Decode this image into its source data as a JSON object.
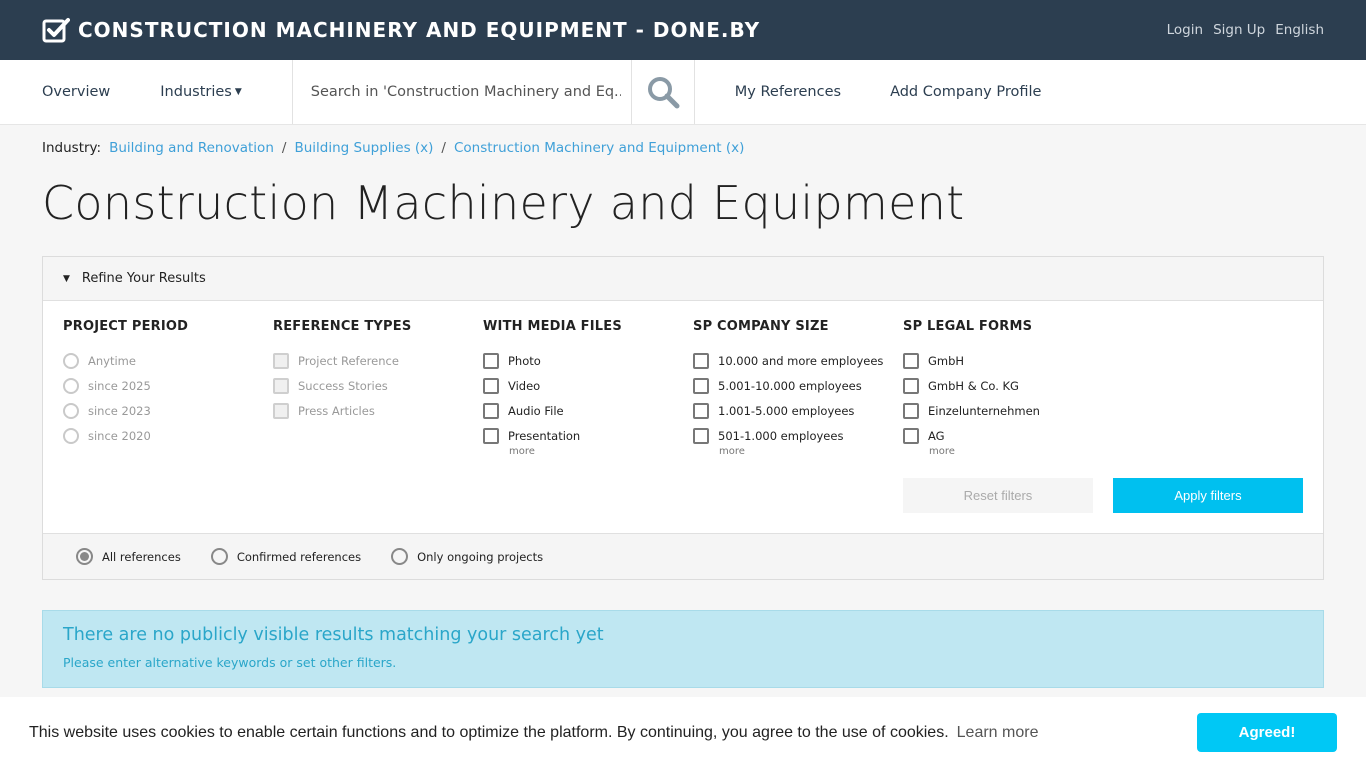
{
  "topbar": {
    "brand": "CONSTRUCTION MACHINERY AND EQUIPMENT - DONE.BY",
    "links": [
      "Login",
      "Sign Up",
      "English"
    ]
  },
  "nav": {
    "overview": "Overview",
    "industries": "Industries",
    "search_placeholder": "Search in 'Construction Machinery and Eq...",
    "my_references": "My References",
    "add_profile": "Add Company Profile"
  },
  "breadcrumb": {
    "label": "Industry:",
    "items": [
      "Building and Renovation",
      "Building Supplies (x)",
      "Construction Machinery and Equipment (x)"
    ]
  },
  "page": {
    "title": "Construction Machinery and Equipment"
  },
  "filters": {
    "header": "Refine Your Results",
    "columns": [
      {
        "title": "PROJECT PERIOD",
        "options": [
          "Anytime",
          "since 2025",
          "since 2023",
          "since 2020"
        ]
      },
      {
        "title": "REFERENCE TYPES",
        "options": [
          "Project Reference",
          "Success Stories",
          "Press Articles"
        ]
      },
      {
        "title": "WITH MEDIA FILES",
        "options": [
          "Photo",
          "Video",
          "Audio File",
          "Presentation"
        ],
        "more": "more"
      },
      {
        "title": "SP COMPANY SIZE",
        "options": [
          "10.000 and more employees",
          "5.001-10.000 employees",
          "1.001-5.000 employees",
          "501-1.000 employees"
        ],
        "more": "more"
      },
      {
        "title": "SP LEGAL FORMS",
        "options": [
          "GmbH",
          "GmbH & Co. KG",
          "Einzelunternehmen",
          "AG"
        ],
        "more": "more"
      }
    ],
    "reset": "Reset filters",
    "apply": "Apply filters",
    "scope": {
      "options": [
        "All references",
        "Confirmed references",
        "Only ongoing projects"
      ],
      "selected": "All references"
    }
  },
  "alert": {
    "title": "There are no publicly visible results matching your search yet",
    "text": "Please enter alternative keywords or set other filters."
  },
  "cookie": {
    "text": "This website uses cookies to enable certain functions and to optimize the platform. By continuing, you agree to the use of cookies.",
    "link": "Learn more",
    "button": "Agreed!"
  },
  "colors": {
    "topbar": "#2c3e50",
    "accent": "#00c0ef",
    "link": "#3fa0d8",
    "alert_bg": "#bfe7f2"
  }
}
